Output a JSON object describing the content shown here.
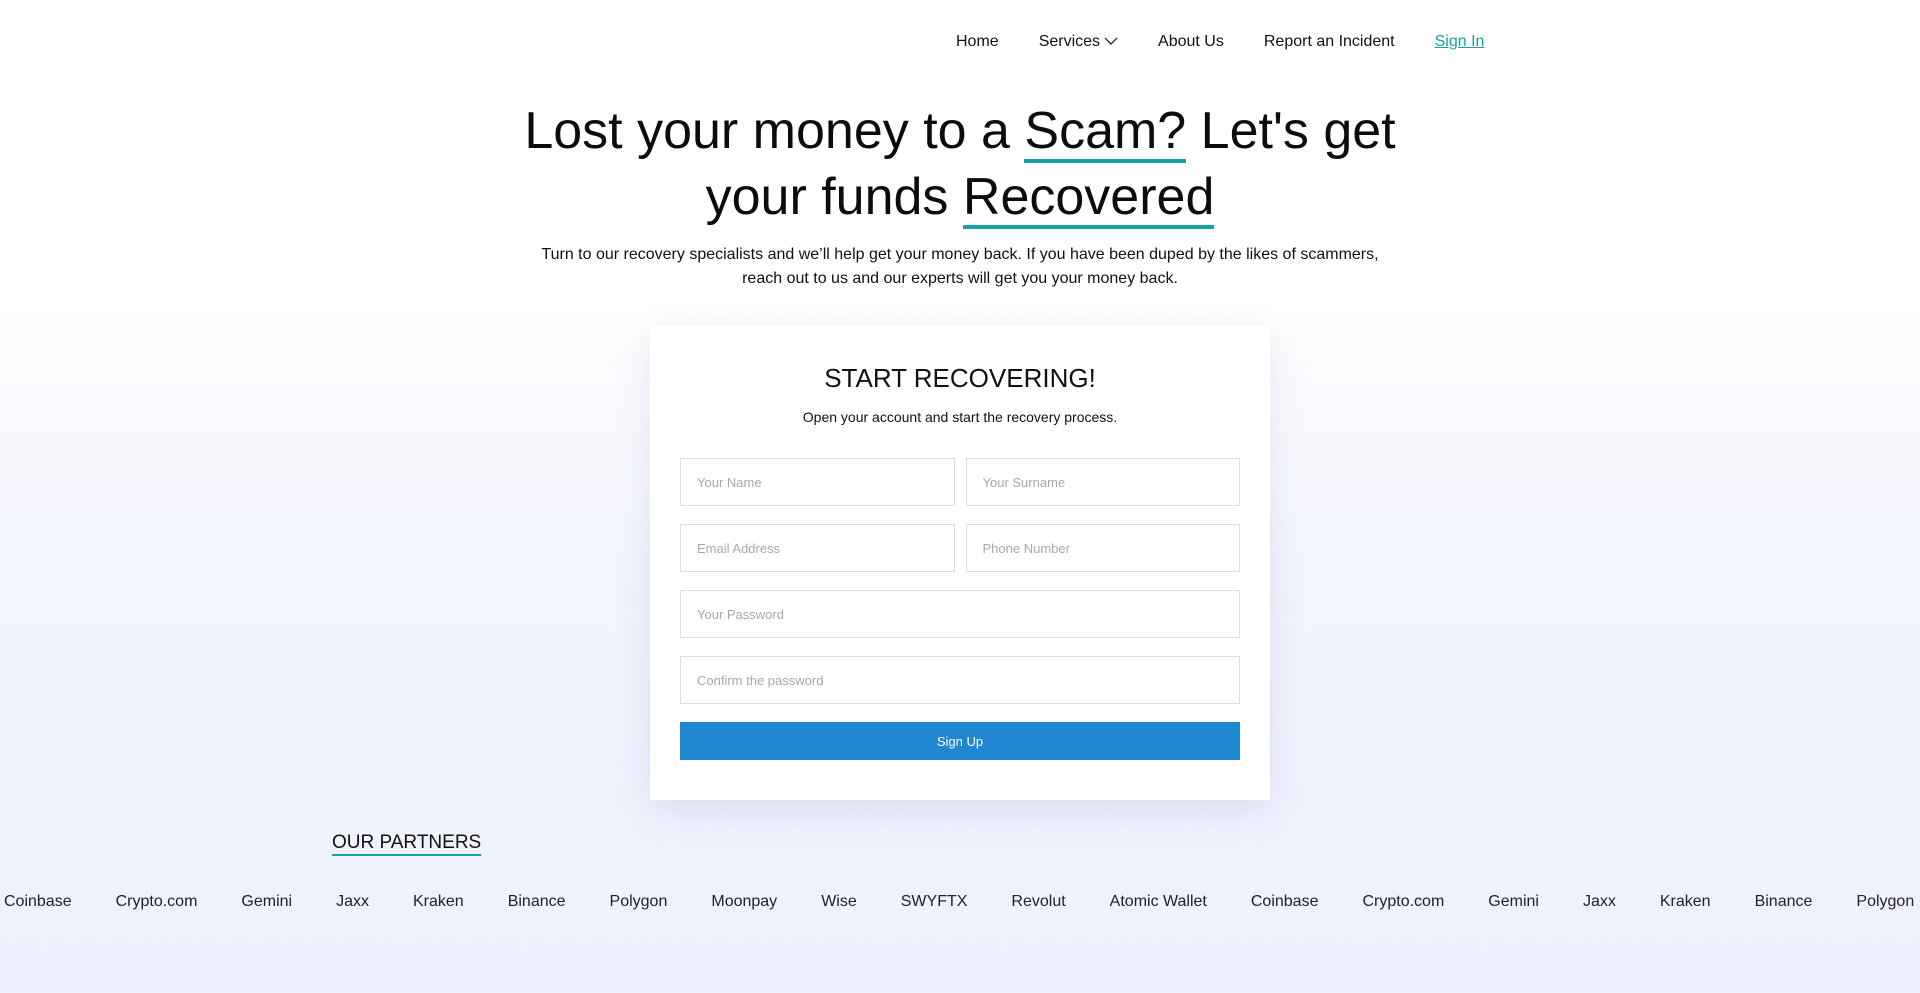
{
  "nav": {
    "items": [
      {
        "label": "Home"
      },
      {
        "label": "Services"
      },
      {
        "label": "About Us"
      },
      {
        "label": "Report an Incident"
      },
      {
        "label": "Sign In"
      }
    ]
  },
  "hero": {
    "title_part1": "Lost your money to a ",
    "title_hl1": "Scam?",
    "title_part2": " Let's get",
    "title_part3": "your funds ",
    "title_hl2": "Recovered",
    "subtitle_line1": "Turn to our recovery specialists and we’ll help get your money back. If you have been duped by the likes of scammers,",
    "subtitle_line2": "reach out to us and our experts will get you your money back."
  },
  "form": {
    "title": "START RECOVERING!",
    "subtitle": "Open your account and start the recovery process.",
    "name_placeholder": "Your Name",
    "surname_placeholder": "Your Surname",
    "email_placeholder": "Email Address",
    "phone_placeholder": "Phone Number",
    "password_placeholder": "Your Password",
    "confirm_placeholder": "Confirm the password",
    "submit_label": "Sign Up"
  },
  "partners": {
    "title": "OUR PARTNERS",
    "items": [
      "Coinbase",
      "Crypto.com",
      "Gemini",
      "Jaxx",
      "Kraken",
      "Binance",
      "Polygon",
      "Moonpay",
      "Wise",
      "SWYFTX",
      "Revolut",
      "Atomic Wallet",
      "Coinbase",
      "Crypto.com",
      "Gemini",
      "Jaxx",
      "Kraken",
      "Binance",
      "Polygon"
    ]
  },
  "colors": {
    "accent_underline": "#13a3a0",
    "signin_link": "#16a3a0",
    "button": "#1e87cf"
  }
}
